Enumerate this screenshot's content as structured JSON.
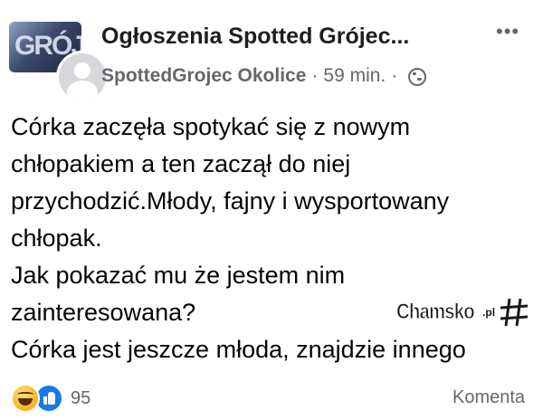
{
  "header": {
    "group_name": "Ogłoszenia Spotted Grójec...",
    "cover_text": "GRÓJ",
    "more_icon": "more-horizontal-icon",
    "author": "SpottedGrojec Okolice",
    "separator": "·",
    "time": "59 min.",
    "separator2": "·",
    "privacy_icon": "globe-icon"
  },
  "post": {
    "lines": [
      "Córka zaczęła spotykać się z nowym",
      "chłopakiem a ten zaczął do niej",
      "przychodzić.Młody, fajny i wysportowany",
      "chłopak.",
      "Jak pokazać mu że jestem nim",
      "zainteresowana?",
      "Córka jest jeszcze młoda, znajdzie innego"
    ]
  },
  "watermark": {
    "text": "Chamsko",
    "suffix": ".pl"
  },
  "footer": {
    "reaction_icons": [
      "haha-icon",
      "like-icon"
    ],
    "reaction_count": "95",
    "comments_label": "Komenta"
  },
  "colors": {
    "text": "#050505",
    "meta": "#65676b",
    "like_blue": "#1877f2",
    "haha_yellow": "#f7b125"
  }
}
